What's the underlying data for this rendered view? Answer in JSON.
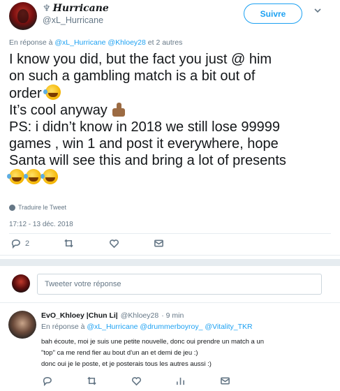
{
  "tweet": {
    "author": {
      "display_name": "Hurricane",
      "name_glyph": "♆",
      "handle": "@xL_Hurricane"
    },
    "follow_label": "Suivre",
    "reply_prefix": "En réponse à",
    "reply_mentions": "@xL_Hurricane @Khloey28",
    "reply_suffix": "et 2 autres",
    "text_lines": [
      "I know you did, but the fact you just @ him",
      "on such a gambling match is a bit out of",
      "order",
      "It’s cool anyway",
      "PS: i didn’t know in 2018 we still lose 99999",
      "games , win 1 and post it everywhere, hope",
      "Santa will see this and bring a lot of presents"
    ],
    "translate_label": "Traduire le Tweet",
    "timestamp": "17:12 - 13 déc. 2018",
    "reply_count": "2",
    "icons": [
      "reply-icon",
      "retweet-icon",
      "like-icon",
      "dm-icon",
      "globe-icon",
      "chevron-down-icon"
    ]
  },
  "composer": {
    "placeholder": "Tweeter votre réponse"
  },
  "reply": {
    "display_name": "EvO_Khloey |Chun Li|",
    "handle": "@Khloey28",
    "time": "· 9 min",
    "reply_prefix": "En réponse à",
    "reply_mentions": "@xL_Hurricane @drummerboyroy_ @Vitality_TKR",
    "text_lines": [
      "bah écoute, moi je suis une petite nouvelle, donc oui prendre un match a un",
      "\"top\" ca me rend fier au bout d'un an et demi de jeu :)",
      "donc oui je le poste, et je posterais tous les autres aussi :)"
    ]
  },
  "colors": {
    "accent": "#1da1f2",
    "muted": "#657786",
    "text": "#14171a",
    "divider": "#e6ecf0"
  }
}
